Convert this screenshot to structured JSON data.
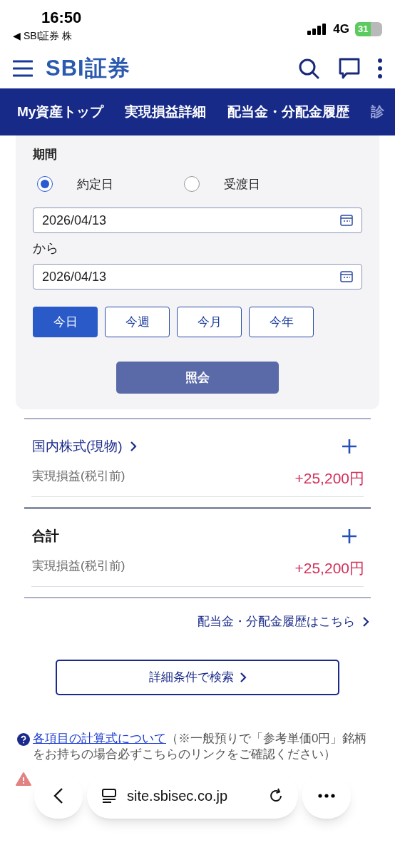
{
  "status_bar": {
    "time": "16:50",
    "back_app": "◀ SBI証券 株",
    "network": "4G",
    "battery": "31"
  },
  "header": {
    "logo": "SBI証券"
  },
  "nav_tabs": [
    {
      "label": "My資産トップ"
    },
    {
      "label": "実現損益詳細"
    },
    {
      "label": "配当金・分配金履歴"
    },
    {
      "label": "診"
    }
  ],
  "filter": {
    "period_label": "期間",
    "date_types": [
      {
        "label": "約定日",
        "selected": true
      },
      {
        "label": "受渡日",
        "selected": false
      }
    ],
    "from_date": "2026/04/13",
    "from_suffix": "から",
    "to_date": "2026/04/13",
    "quick_ranges": [
      {
        "label": "今日",
        "selected": true
      },
      {
        "label": "今週",
        "selected": false
      },
      {
        "label": "今月",
        "selected": false
      },
      {
        "label": "今年",
        "selected": false
      }
    ],
    "submit": "照会"
  },
  "sections": [
    {
      "title": "国内株式(現物)",
      "link": true,
      "label": "実現損益(税引前)",
      "value": "+25,200円"
    },
    {
      "title": "合計",
      "link": false,
      "label": "実現損益(税引前)",
      "value": "+25,200円"
    }
  ],
  "dividend_link": "配当金・分配金履歴はこちら",
  "detail_search": "詳細条件で検索",
  "notes": {
    "link": "各項目の計算式について",
    "text": "（※一般預りで「参考単価0円」銘柄をお持ちの場合必ずこちらのリンクをご確認ください）"
  },
  "browser_bar": {
    "url": "site.sbisec.co.jp"
  }
}
